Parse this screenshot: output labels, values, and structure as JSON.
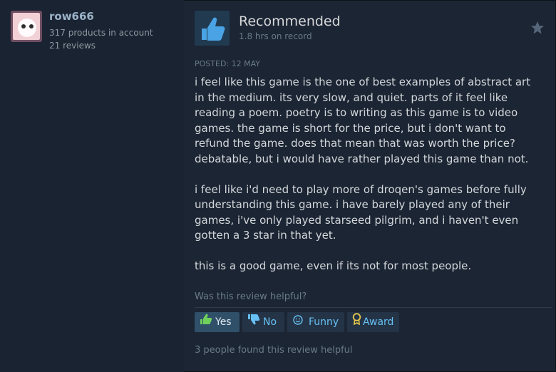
{
  "user": {
    "name": "row666",
    "products": "317 products in account",
    "reviews": "21 reviews"
  },
  "review": {
    "verdict": "Recommended",
    "hours": "1.8 hrs on record",
    "posted": "POSTED: 12 MAY",
    "paragraphs": [
      "i feel like this game is the one of best examples of abstract art in the medium. its very slow, and quiet. parts of it feel like reading a poem. poetry is to writing as this game is to video games. the game is short for the price, but i don't want to refund the game. does that mean that was worth the price? debatable, but i would have rather played this game than not.",
      "i feel like i'd need to play more of droqen's games before fully understanding this game. i have barely played any of their games, i've only played starseed pilgrim, and i haven't even gotten a 3 star in that yet.",
      "this is a good game, even if its not for most people."
    ]
  },
  "feedback": {
    "question": "Was this review helpful?",
    "yes": "Yes",
    "no": "No",
    "funny": "Funny",
    "award": "Award",
    "found": "3 people found this review helpful"
  },
  "icons": {
    "thumb_up": "thumbs-up-icon",
    "thumb_down": "thumbs-down-icon",
    "funny": "smiley-icon",
    "award": "award-icon",
    "star": "star-icon"
  },
  "colors": {
    "background": "#1b2534",
    "accent": "#66c0f4",
    "thumb_blue": "#4aa3e4",
    "yes_active": "#30506a"
  }
}
